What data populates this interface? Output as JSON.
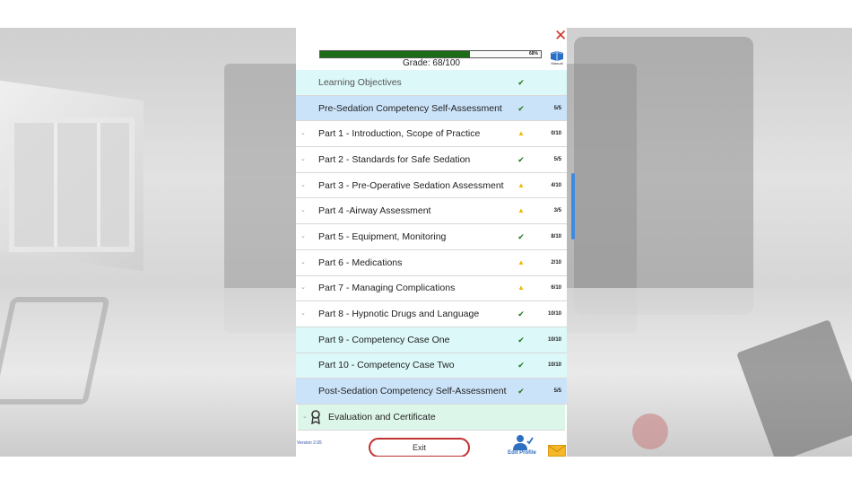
{
  "grade": {
    "progress": 0.68,
    "percent_text": "68%",
    "label": "Grade:  68/100"
  },
  "manual": {
    "label": "Manual",
    "icon": "book-icon"
  },
  "close": {
    "icon": "close-x-icon",
    "symbol": "✕"
  },
  "rows": [
    {
      "label": "Learning Objectives",
      "status": "✔",
      "score": "",
      "style": "cyan",
      "chevron": ""
    },
    {
      "label": "Pre-Sedation Competency Self-Assessment",
      "status": "✔",
      "score": "5/5",
      "style": "blue",
      "chevron": ""
    },
    {
      "label": "Part 1 - Introduction, Scope of Practice",
      "status": "▲",
      "score": "0/10",
      "style": "white",
      "chevron": "⌄"
    },
    {
      "label": "Part 2 - Standards for Safe Sedation",
      "status": "✔",
      "score": "5/5",
      "style": "white",
      "chevron": "⌄"
    },
    {
      "label": "Part 3 - Pre-Operative Sedation Assessment",
      "status": "▲",
      "score": "4/10",
      "style": "white",
      "chevron": "⌄"
    },
    {
      "label": "Part 4 -Airway Assessment",
      "status": "▲",
      "score": "3/5",
      "style": "white",
      "chevron": "⌄"
    },
    {
      "label": "Part 5 - Equipment, Monitoring",
      "status": "✔",
      "score": "8/10",
      "style": "white",
      "chevron": "⌄"
    },
    {
      "label": "Part 6 - Medications",
      "status": "▲",
      "score": "2/10",
      "style": "white",
      "chevron": "⌄"
    },
    {
      "label": "Part 7 - Managing Complications",
      "status": "▲",
      "score": "6/10",
      "style": "white",
      "chevron": "⌄"
    },
    {
      "label": "Part 8 - Hypnotic Drugs and Language",
      "status": "✔",
      "score": "10/10",
      "style": "white",
      "chevron": "⌄"
    },
    {
      "label": "Part 9 - Competency Case One",
      "status": "✔",
      "score": "10/10",
      "style": "cyan",
      "chevron": ""
    },
    {
      "label": "Part 10 - Competency Case Two",
      "status": "✔",
      "score": "10/10",
      "style": "cyan",
      "chevron": ""
    },
    {
      "label": "Post-Sedation Competency Self-Assessment",
      "status": "✔",
      "score": "5/5",
      "style": "blue",
      "chevron": ""
    }
  ],
  "evaluation": {
    "label": "Evaluation and Certificate",
    "icon": "award-ribbon-icon",
    "chevron": "⌄"
  },
  "footer": {
    "version": "Version 2.65",
    "exit_label": "Exit",
    "edit_profile_label": "Edit Profile",
    "mail_icon": "envelope-icon"
  },
  "colors": {
    "progress_fill": "#1c6b16",
    "check": "#1f7a1f",
    "warning": "#f0b800",
    "close": "#d2322d",
    "exit_border": "#c23030",
    "scroll": "#3f8be0"
  }
}
